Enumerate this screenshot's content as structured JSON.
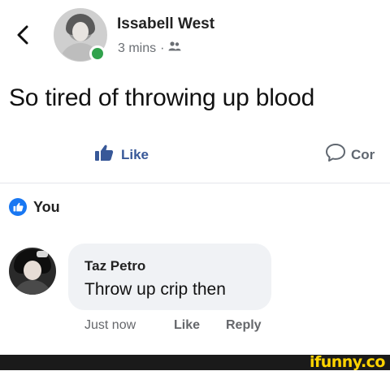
{
  "post": {
    "author_name": "Issabell West",
    "timestamp": "3 mins",
    "separator": "·",
    "audience_icon": "friends-icon",
    "text": "So tired of throwing up blood"
  },
  "actions": {
    "like_label": "Like",
    "comment_label": "Cor"
  },
  "reactions": {
    "reactor": "You"
  },
  "comment": {
    "author_name": "Taz Petro",
    "text": "Throw up crip then",
    "timestamp": "Just now",
    "like_label": "Like",
    "reply_label": "Reply"
  },
  "watermark": {
    "text": "ifunny.co"
  },
  "colors": {
    "link_blue": "#385898",
    "like_badge": "#1877f2",
    "online_green": "#31a24c",
    "bubble_bg": "#f0f2f5",
    "watermark_yellow": "#ffd400"
  }
}
